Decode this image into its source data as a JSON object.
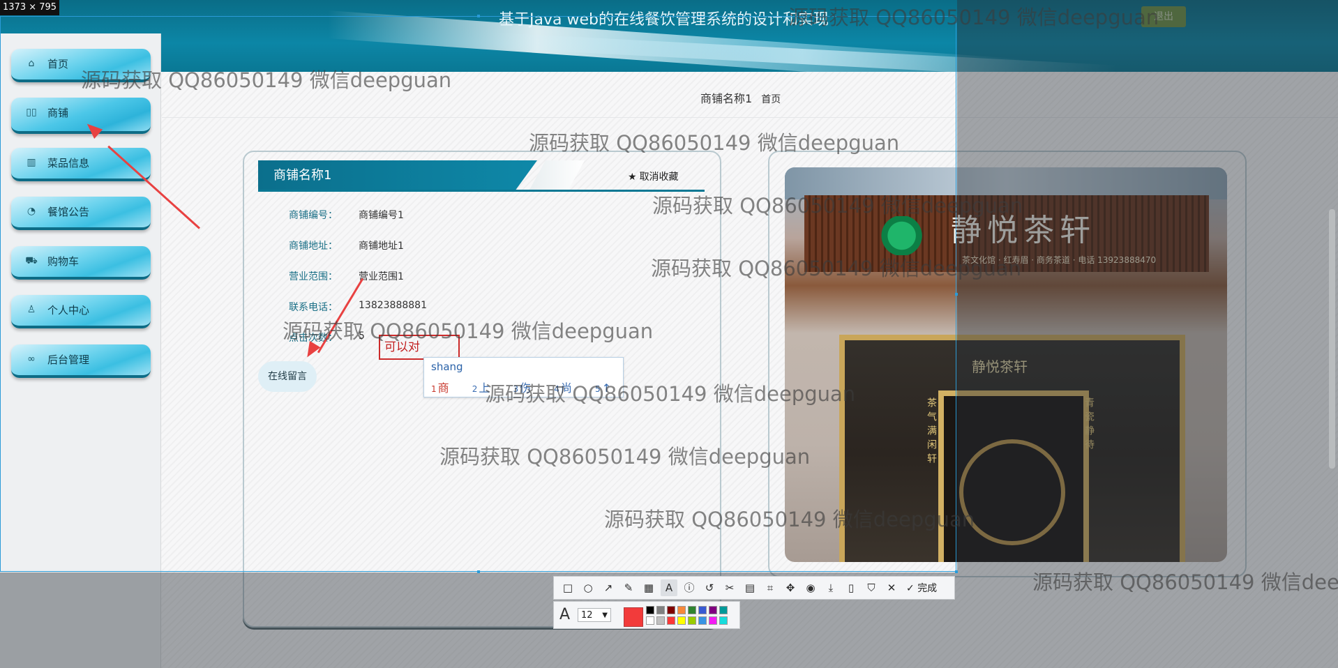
{
  "window": {
    "dimension_label": "1373 × 795"
  },
  "header": {
    "title": "基于Java web的在线餐饮管理系统的设计和实现",
    "logout_label": "退出"
  },
  "sidebar": {
    "items": [
      {
        "label": "首页",
        "icon": "home-icon"
      },
      {
        "label": "商铺",
        "icon": "columns-icon",
        "active": true
      },
      {
        "label": "菜品信息",
        "icon": "shop-icon"
      },
      {
        "label": "餐馆公告",
        "icon": "gauge-icon"
      },
      {
        "label": "购物车",
        "icon": "cart-icon"
      },
      {
        "label": "个人中心",
        "icon": "user-icon"
      },
      {
        "label": "后台管理",
        "icon": "link-icon"
      }
    ]
  },
  "breadcrumb": {
    "current": "商铺名称1",
    "home": "首页"
  },
  "shop": {
    "title": "商铺名称1",
    "favorite_label": "取消收藏",
    "fields": [
      {
        "key": "商铺编号：",
        "value": "商铺编号1"
      },
      {
        "key": "商铺地址：",
        "value": "商铺地址1"
      },
      {
        "key": "营业范围：",
        "value": "营业范围1"
      },
      {
        "key": "联系电话：",
        "value": "13823888881"
      },
      {
        "key": "点击次数：",
        "value": "5"
      }
    ],
    "message_button": "在线留言",
    "photo": {
      "sign": "静悦茶轩",
      "sign_sub": "茶文化馆 · 红寿眉 · 商务茶道 · 电话 13923888470",
      "inner_sign": "静悦茶轩",
      "pillar_left": "茶气满闲轩",
      "pillar_right": "青瓷静待"
    }
  },
  "ime": {
    "typed_text": "可以对",
    "composition": "shang",
    "candidates": [
      {
        "n": "1",
        "text": "商"
      },
      {
        "n": "2",
        "text": "上"
      },
      {
        "n": "3",
        "text": "伤"
      },
      {
        "n": "4",
        "text": "尚"
      },
      {
        "n": "5",
        "text": "↑"
      }
    ]
  },
  "watermark": "源码获取 QQ86050149 微信deepguan",
  "screenshot_tool": {
    "done_label": "完成",
    "font_size": "12",
    "current_color": "#f23b3b",
    "palette": [
      "#000000",
      "#808080",
      "#800000",
      "#f7883a",
      "#308430",
      "#385ad3",
      "#800080",
      "#009999",
      "#ffffff",
      "#c0c0c0",
      "#fb3838",
      "#ffff00",
      "#99cc00",
      "#3894e4",
      "#f31bf3",
      "#16dcdc"
    ]
  }
}
